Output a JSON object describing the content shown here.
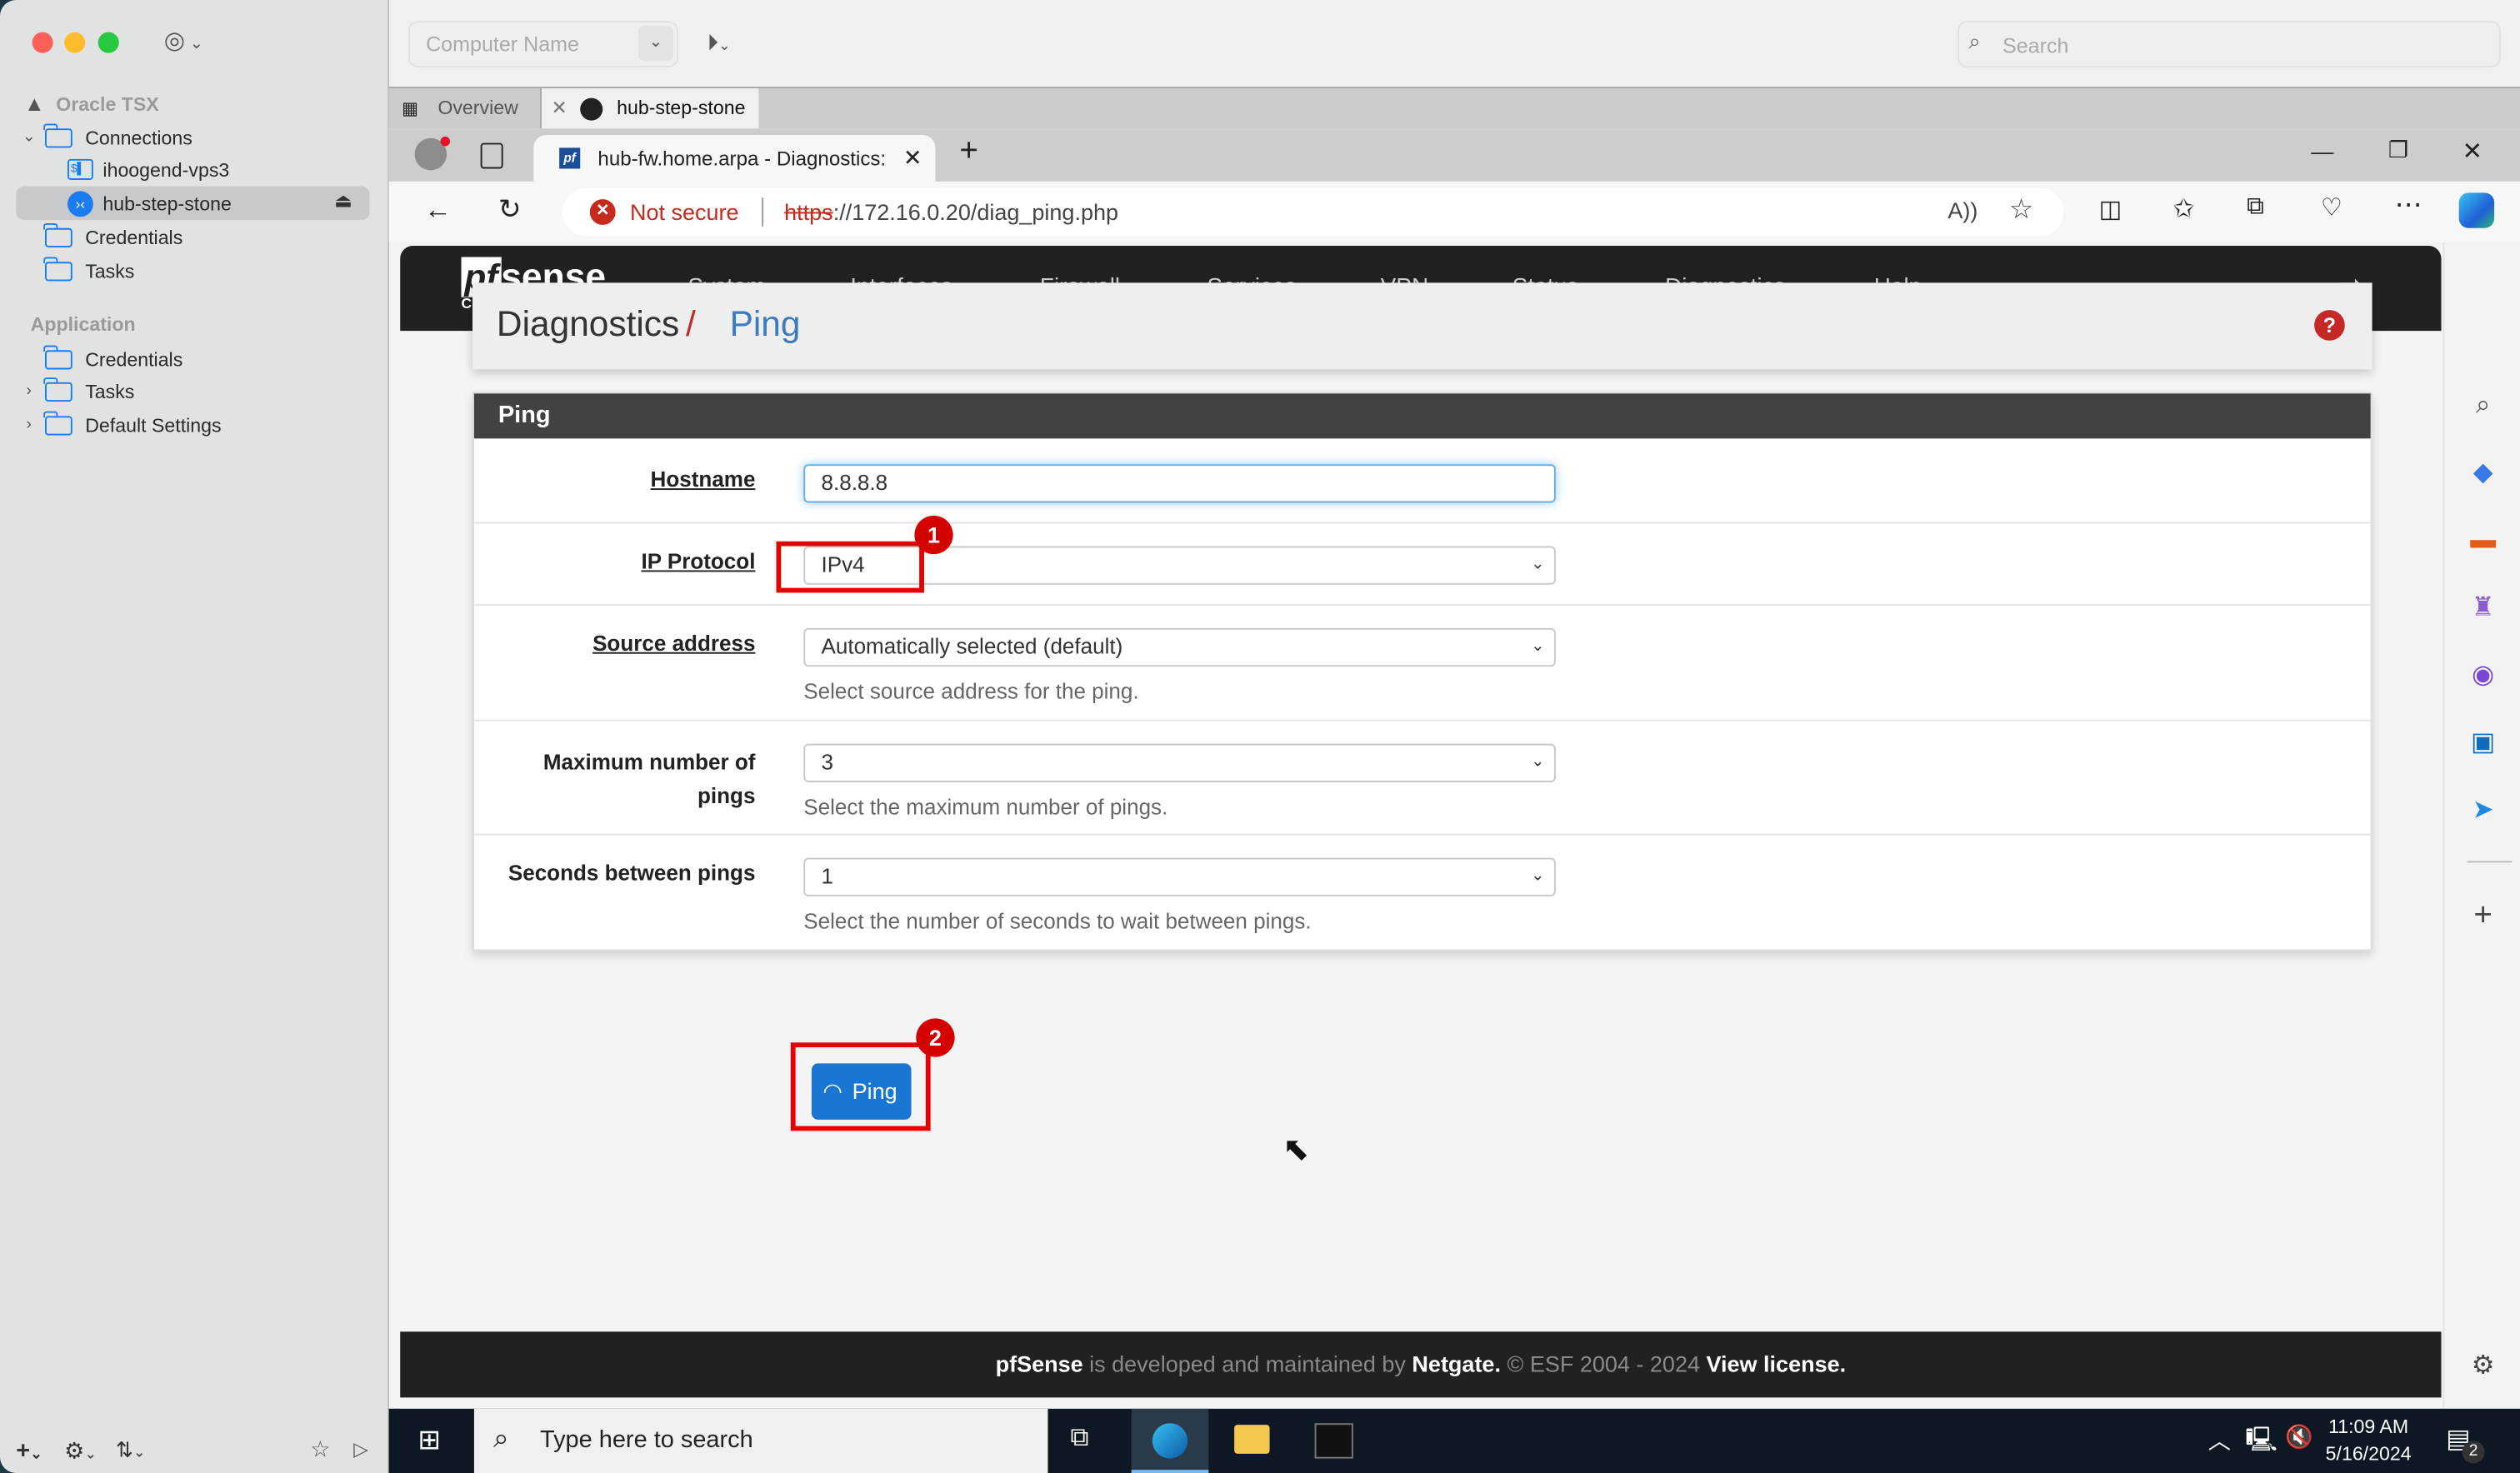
{
  "mac_app": {
    "sidebar": {
      "group_title": "Oracle TSX",
      "connections_label": "Connections",
      "connections": [
        {
          "name": "ihoogend-vps3",
          "type": "ssh"
        },
        {
          "name": "hub-step-stone",
          "type": "rdp",
          "selected": true
        }
      ],
      "group_items": [
        "Credentials",
        "Tasks"
      ],
      "application_title": "Application",
      "application_items": [
        "Credentials",
        "Tasks",
        "Default Settings"
      ]
    },
    "toolbar": {
      "computer_name_placeholder": "Computer Name",
      "search_placeholder": "Search"
    },
    "tabs": [
      {
        "label": "Overview"
      },
      {
        "label": "hub-step-stone",
        "active": true
      }
    ]
  },
  "browser": {
    "tab_title": "hub-fw.home.arpa - Diagnostics:",
    "security_label": "Not secure",
    "url_scheme": "https",
    "url_rest": "://172.16.0.20/diag_ping.php",
    "window_controls": [
      "minimize",
      "restore",
      "close"
    ]
  },
  "pfsense": {
    "brand": "sense",
    "brand_prefix": "pf",
    "edition": "COMMUNITY EDITION",
    "nav": [
      "System",
      "Interfaces",
      "Firewall",
      "Services",
      "VPN",
      "Status",
      "Diagnostics",
      "Help"
    ],
    "breadcrumb": {
      "parent": "Diagnostics",
      "separator": "/",
      "current": "Ping"
    },
    "panel_title": "Ping",
    "form": {
      "hostname": {
        "label": "Hostname",
        "value": "8.8.8.8"
      },
      "ip_protocol": {
        "label": "IP Protocol",
        "value": "IPv4"
      },
      "source_address": {
        "label": "Source address",
        "value": "Automatically selected (default)",
        "help": "Select source address for the ping."
      },
      "max_pings": {
        "label_line1": "Maximum number of",
        "label_line2": "pings",
        "value": "3",
        "help": "Select the maximum number of pings."
      },
      "seconds_between": {
        "label": "Seconds between pings",
        "value": "1",
        "help": "Select the number of seconds to wait between pings."
      }
    },
    "ping_button": "Ping",
    "footer": {
      "brand": "pfSense",
      "text1": " is developed and maintained by ",
      "netgate": "Netgate.",
      "text2": " © ESF 2004 - 2024 ",
      "license": "View license."
    }
  },
  "annotations": [
    {
      "number": "1"
    },
    {
      "number": "2"
    }
  ],
  "taskbar": {
    "search_placeholder": "Type here to search",
    "time": "11:09 AM",
    "date": "5/16/2024",
    "notifications": "2"
  },
  "colors": {
    "accent": "#1a7cf0",
    "pf_button": "#1976d2",
    "annotation": "#e60000",
    "not_secure": "#c42b1c"
  }
}
